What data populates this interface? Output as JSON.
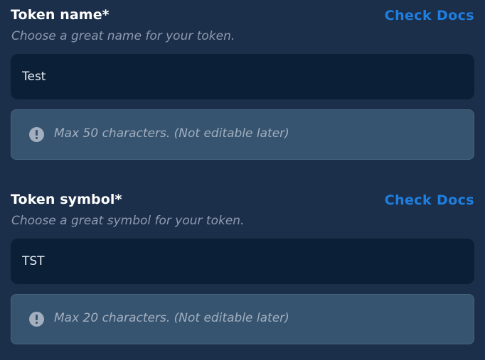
{
  "fields": [
    {
      "label": "Token name*",
      "docs_link": "Check Docs",
      "subtitle": "Choose a great name for your token.",
      "value": "Test",
      "note": "Max 50 characters. (Not editable later)",
      "note_icon": "exclamation-circle-icon"
    },
    {
      "label": "Token symbol*",
      "docs_link": "Check Docs",
      "subtitle": "Choose a great symbol for your token.",
      "value": "TST",
      "note": "Max 20 characters. (Not editable later)",
      "note_icon": "exclamation-circle-icon"
    }
  ],
  "colors": {
    "background": "#1c2f4a",
    "input_background": "#0b1f36",
    "note_background": "#365470",
    "link": "#1f7fe0",
    "label": "#ffffff",
    "subtitle": "#8d9ab0"
  }
}
